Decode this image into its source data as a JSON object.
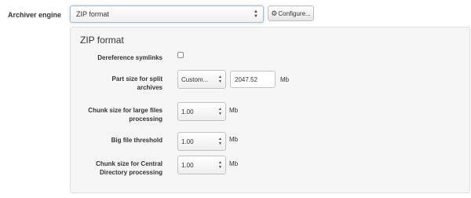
{
  "archiver": {
    "label": "Archiver engine",
    "selected": "ZIP format",
    "configure_label": "Configure..."
  },
  "panel": {
    "title": "ZIP format",
    "dereference": {
      "label": "Dereference symlinks",
      "checked": false
    },
    "part_size": {
      "label_line1": "Part size for split",
      "label_line2": "archives",
      "select_value": "Custom...",
      "input_value": "2047.52",
      "unit": "Mb"
    },
    "chunk_large": {
      "label_line1": "Chunk size for large files",
      "label_line2": "processing",
      "value": "1.00",
      "unit": "Mb"
    },
    "big_file": {
      "label": "Big file threshold",
      "value": "1.00",
      "unit": "Mb"
    },
    "chunk_central": {
      "label_line1": "Chunk size for Central",
      "label_line2": "Directory processing",
      "value": "1.00",
      "unit": "Mb"
    }
  },
  "icons": {
    "gear": "gear-icon",
    "caret": "updown-caret-icon"
  },
  "colors": {
    "panel_bg": "#f5f5f5",
    "focus_glow": "#52a8ec"
  }
}
